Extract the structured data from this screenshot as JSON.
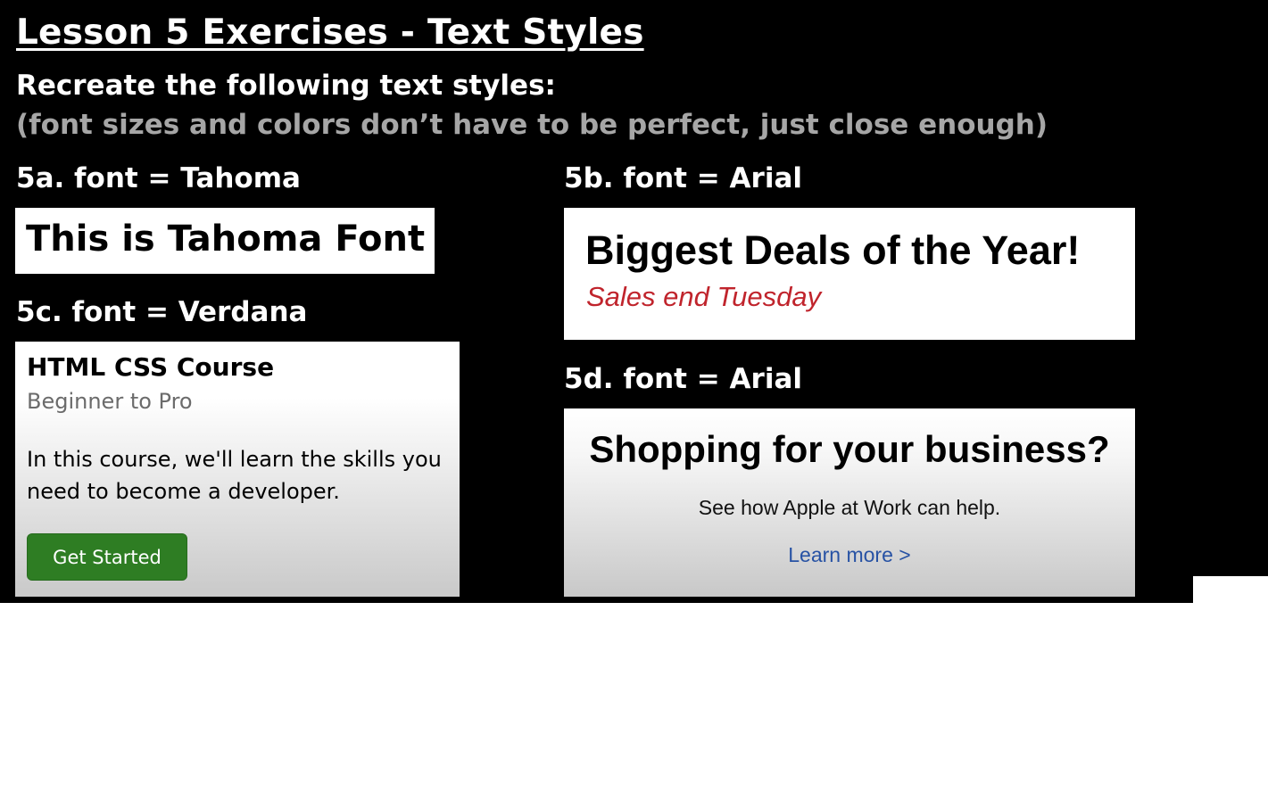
{
  "header": {
    "title": "Lesson 5 Exercises - Text Styles",
    "subtitle": "Recreate the following text styles:",
    "note": "(font sizes and colors don’t have to be perfect, just close enough)"
  },
  "exercises": {
    "ex5a": {
      "label": "5a. font = Tahoma",
      "text": "This is Tahoma Font"
    },
    "ex5b": {
      "label": "5b. font = Arial",
      "title": "Biggest Deals of the Year!",
      "subtitle": "Sales end Tuesday",
      "subtitle_color": "#c0242c"
    },
    "ex5c": {
      "label": "5c. font = Verdana",
      "title": "HTML CSS Course",
      "level": "Beginner to Pro",
      "description": "In this course, we'll learn the skills you need to become a developer.",
      "button_label": "Get Started",
      "button_color": "#2e7d23"
    },
    "ex5d": {
      "label": "5d. font = Arial",
      "title": "Shopping for your business?",
      "subtitle": "See how Apple at Work can help.",
      "link_text": "Learn more >",
      "link_color": "#2752a4"
    }
  }
}
